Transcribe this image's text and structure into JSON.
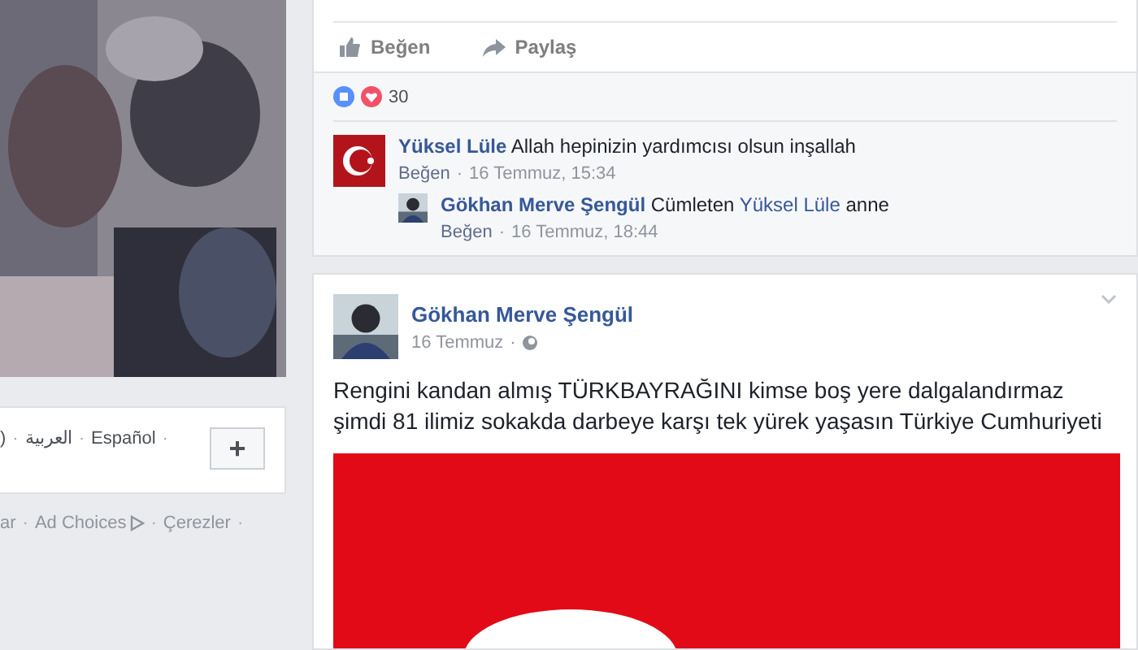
{
  "separator": "·",
  "left_panel": {
    "languages": [
      ")",
      "العربية",
      "Español"
    ],
    "add_button": "+",
    "footer_links": [
      {
        "label": "ar",
        "kind": "text"
      },
      {
        "label": "Ad Choices",
        "kind": "adchoices"
      },
      {
        "label": "Çerezler",
        "kind": "text"
      }
    ]
  },
  "post_1": {
    "actions": [
      {
        "label": "Beğen",
        "kind": "like"
      },
      {
        "label": "Paylaş",
        "kind": "share"
      }
    ],
    "reaction_count": "30",
    "comments": [
      {
        "author": "Yüksel Lüle",
        "text": "Allah hepinizin yardımcısı olsun inşallah",
        "like": "Beğen",
        "time": "16 Temmuz, 15:34",
        "avatar": {
          "kind": "flag"
        },
        "replies": [
          {
            "author": "Gökhan Merve Şengül",
            "text_before": "Cümleten",
            "mention": "Yüksel Lüle",
            "text_after": "anne",
            "like": "Beğen",
            "time": "16 Temmuz, 18:44"
          }
        ]
      }
    ]
  },
  "post_2": {
    "author": "Gökhan Merve Şengül",
    "date": "16 Temmuz",
    "text_lines": [
      "Rengini kandan almış TÜRKBAYRAĞINI kimse boş yere dalgalandırmaz",
      "şimdi 81 ilimiz sokakda darbeye karşı tek yürek yaşasın Türkiye Cumhuriyeti"
    ]
  }
}
